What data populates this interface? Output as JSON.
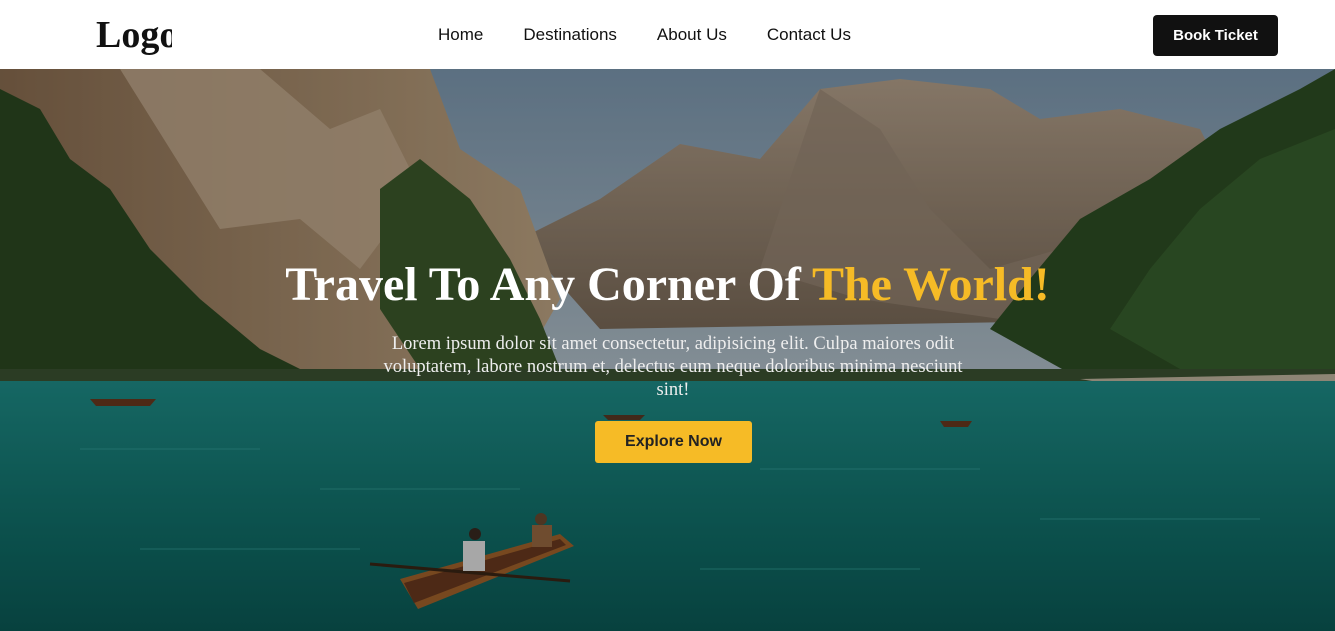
{
  "navbar": {
    "logo": "Logo",
    "links": [
      "Home",
      "Destinations",
      "About Us",
      "Contact Us"
    ],
    "cta_label": "Book Ticket"
  },
  "hero": {
    "title_main": "Travel To Any Corner Of ",
    "title_accent": "The World!",
    "description": "Lorem ipsum dolor sit amet consectetur, adipisicing elit. Culpa maiores odit voluptatem, labore nostrum et, delectus eum neque doloribus minima nesciunt sint!",
    "button_label": "Explore Now"
  },
  "colors": {
    "accent": "#f6bb26",
    "dark": "#111111",
    "lake": "#0f6e6a"
  }
}
